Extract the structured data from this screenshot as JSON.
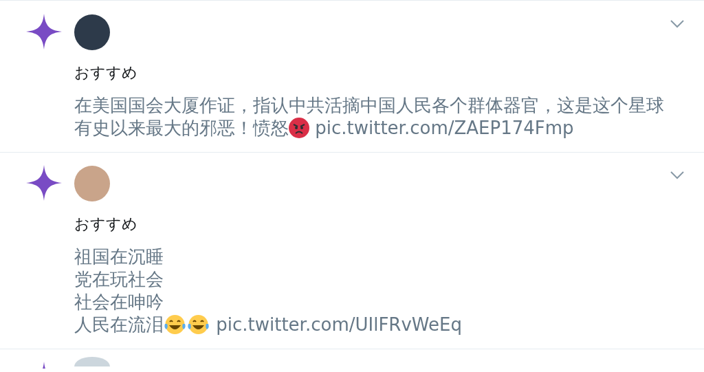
{
  "posts": [
    {
      "label": "おすすめ",
      "segments": [
        {
          "kind": "text",
          "text": "在美国国会大厦作证，指认中共活摘中国人民各个群体器官，这是这个星球有史以来最大的邪恶！愤怒"
        },
        {
          "kind": "angry"
        },
        {
          "kind": "link",
          "text": " pic.twitter.com/ZAEP174Fmp"
        }
      ]
    },
    {
      "label": "おすすめ",
      "segments": [
        {
          "kind": "line",
          "text": "祖国在沉睡"
        },
        {
          "kind": "line",
          "text": "党在玩社会"
        },
        {
          "kind": "line",
          "text": "社会在呻吟"
        },
        {
          "kind": "text",
          "text": "人民在流泪"
        },
        {
          "kind": "laughing"
        },
        {
          "kind": "laughing"
        },
        {
          "kind": "link",
          "text": " pic.twitter.com/UIlFRvWeEq"
        }
      ]
    }
  ]
}
